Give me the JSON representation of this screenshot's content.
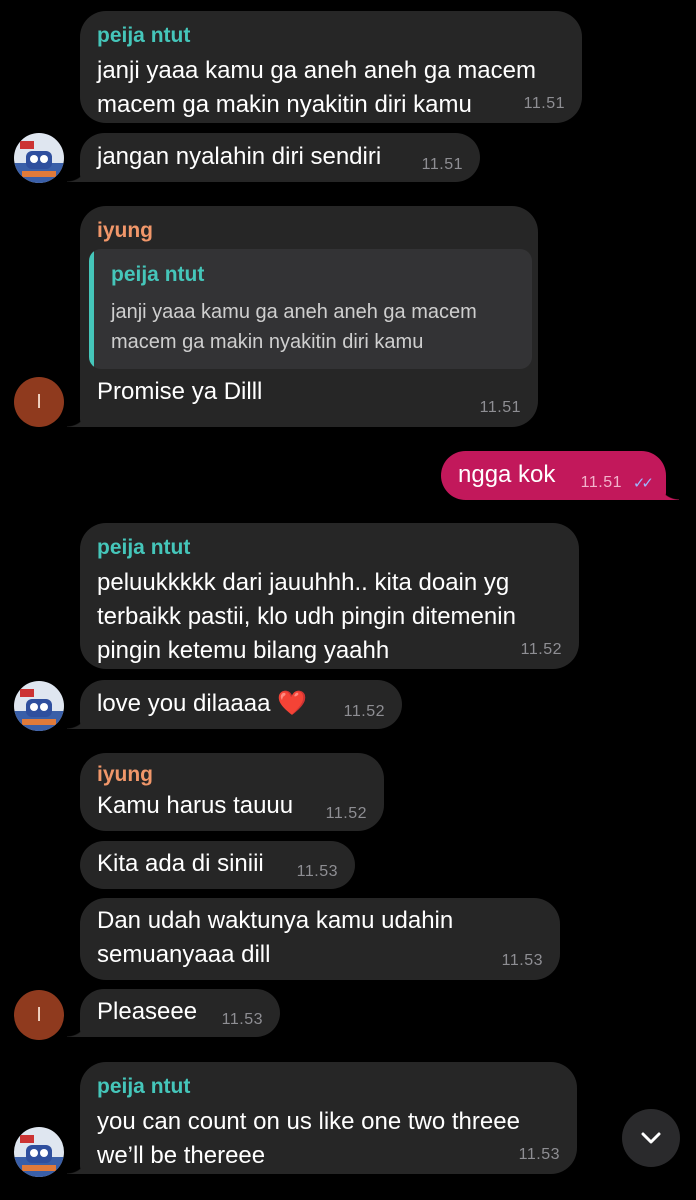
{
  "messages": [
    {
      "sender": "peija ntut",
      "text": "janji yaaa kamu ga aneh aneh ga macem\nmacem ga makin nyakitin diri kamu",
      "time": "11.51"
    },
    {
      "sender": "",
      "text": "jangan nyalahin diri sendiri",
      "time": "11.51"
    },
    {
      "sender": "iyung",
      "reply": {
        "name": "peija ntut",
        "text": "janji yaaa kamu ga aneh aneh ga macem\nmacem ga makin nyakitin diri kamu"
      },
      "text": "Promise ya Dilll",
      "time": "11.51"
    },
    {
      "sender": "",
      "text": "ngga kok",
      "time": "11.51",
      "status": "read"
    },
    {
      "sender": "peija ntut",
      "text": "peluukkkkk dari jauuhhh.. kita doain yg\nterbaikk pastii, klo udh pingin ditemenin\npingin ketemu bilang yaahh",
      "time": "11.52"
    },
    {
      "sender": "",
      "text": "love you dilaaaa ❤️",
      "time": "11.52"
    },
    {
      "sender": "iyung",
      "text": "Kamu harus tauuu",
      "time": "11.52"
    },
    {
      "sender": "",
      "text": "Kita ada di siniii",
      "time": "11.53"
    },
    {
      "sender": "",
      "text": "Dan udah waktunya kamu udahin\nsemuanyaaa dill",
      "time": "11.53"
    },
    {
      "sender": "",
      "text": "Pleaseee",
      "time": "11.53"
    },
    {
      "sender": "peija ntut",
      "text": "you can count on us like one two threee\nwe’ll be thereee",
      "time": "11.53"
    }
  ],
  "avatar_letter": "I",
  "icons": {
    "read_ticks": "✓✓",
    "scroll_down": "chevron-down-icon"
  },
  "colors": {
    "incoming_bubble": "#262626",
    "outgoing_bubble": "#c2185b",
    "sender_peija": "#45c6ba",
    "sender_iyung": "#f1976a"
  }
}
